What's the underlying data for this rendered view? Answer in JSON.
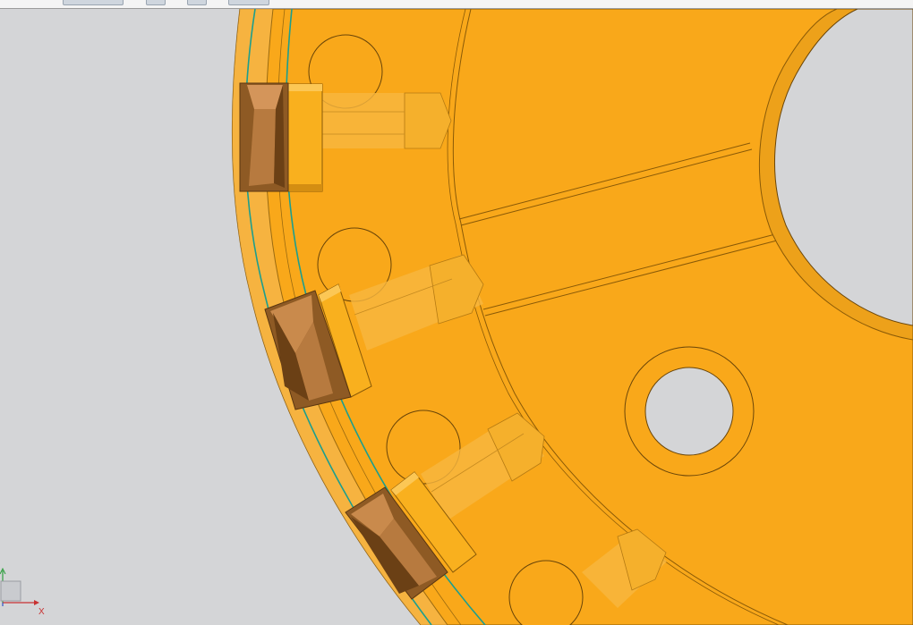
{
  "toolbar": {
    "buttons": [
      "toolbar-button-1",
      "toolbar-button-2",
      "toolbar-button-3",
      "toolbar-button-4"
    ]
  },
  "viewport": {
    "background": "#d4d5d7",
    "part_color": "#f9a81a",
    "part_edge_color": "#8a5a07",
    "cutter_color": "#b77a3f",
    "toolpath_color": "#1c9e8e"
  },
  "triad": {
    "x_label": "X",
    "x_color": "#c83232",
    "y_color": "#2e9e3e",
    "z_color": "#2f52c8"
  }
}
